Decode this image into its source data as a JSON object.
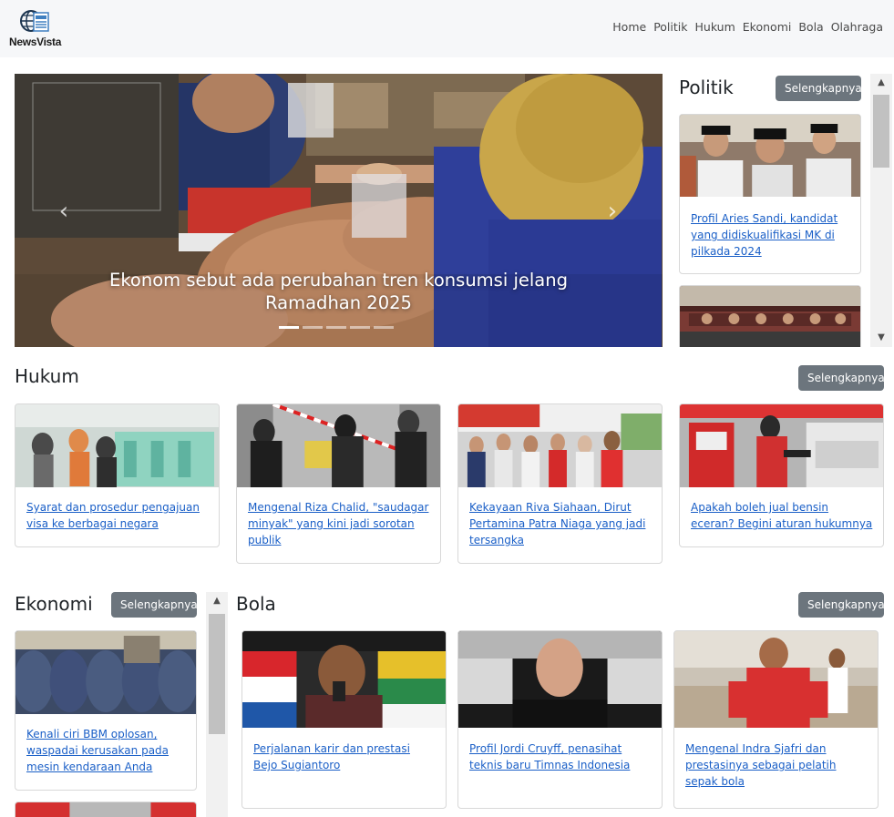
{
  "brand": {
    "name": "NewsVista"
  },
  "nav": {
    "items": [
      "Home",
      "Politik",
      "Hukum",
      "Ekonomi",
      "Bola",
      "Olahraga"
    ]
  },
  "carousel": {
    "caption": "Ekonom sebut ada perubahan tren konsumsi jelang Ramadhan 2025",
    "prev_icon": "chevron-left-icon",
    "next_icon": "chevron-right-icon",
    "slide_count": 5,
    "active_index": 0
  },
  "more_label": "Selengkapnya",
  "politik": {
    "title": "Politik",
    "cards": [
      {
        "title": "Profil Aries Sandi, kandidat yang didiskualifikasi MK di pilkada 2024"
      },
      {
        "title": ""
      }
    ]
  },
  "hukum": {
    "title": "Hukum",
    "cards": [
      {
        "title": "Syarat dan prosedur pengajuan visa ke berbagai negara"
      },
      {
        "title": "Mengenal Riza Chalid, \"saudagar minyak\" yang kini jadi sorotan publik"
      },
      {
        "title": "Kekayaan Riva Siahaan, Dirut Pertamina Patra Niaga yang jadi tersangka"
      },
      {
        "title": "Apakah boleh jual bensin eceran? Begini aturan hukumnya"
      }
    ]
  },
  "ekonomi": {
    "title": "Ekonomi",
    "cards": [
      {
        "title": "Kenali ciri BBM oplosan, waspadai kerusakan pada mesin kendaraan Anda"
      },
      {
        "title": ""
      }
    ]
  },
  "bola": {
    "title": "Bola",
    "cards": [
      {
        "title": "Perjalanan karir dan prestasi Bejo Sugiantoro"
      },
      {
        "title": "Profil Jordi Cruyff, penasihat teknis baru Timnas Indonesia"
      },
      {
        "title": "Mengenal Indra Sjafri dan prestasinya sebagai pelatih sepak bola"
      }
    ]
  },
  "colors": {
    "navbar_bg": "#f6f7f9",
    "link": "#1a5fc7",
    "button_bg": "#6c757d",
    "scrollbar_track": "#f1f1f1",
    "scrollbar_thumb": "#c1c1c1"
  }
}
